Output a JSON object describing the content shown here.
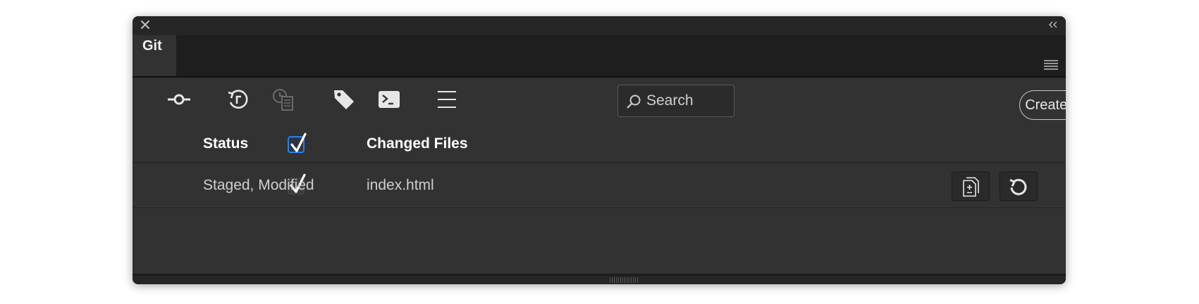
{
  "window": {
    "tab_label": "Git"
  },
  "toolbar": {
    "icons": [
      "commit-icon",
      "history-icon",
      "file-history-icon",
      "tag-icon",
      "terminal-icon",
      "menu-icon"
    ],
    "search_placeholder": "Search",
    "create_remote_label": "Create Remote"
  },
  "table": {
    "header_checked": true,
    "columns": {
      "status": "Status",
      "changed_files": "Changed Files"
    },
    "rows": [
      {
        "checked": true,
        "status": "Staged, Modified",
        "file": "index.html",
        "actions": [
          "diff-icon",
          "discard-icon"
        ]
      }
    ]
  },
  "colors": {
    "panel_bg": "#323232",
    "titlebar_bg": "#262626",
    "accent": "#2680eb",
    "text_primary": "#ffffff",
    "text_secondary": "#cfcfcf"
  }
}
